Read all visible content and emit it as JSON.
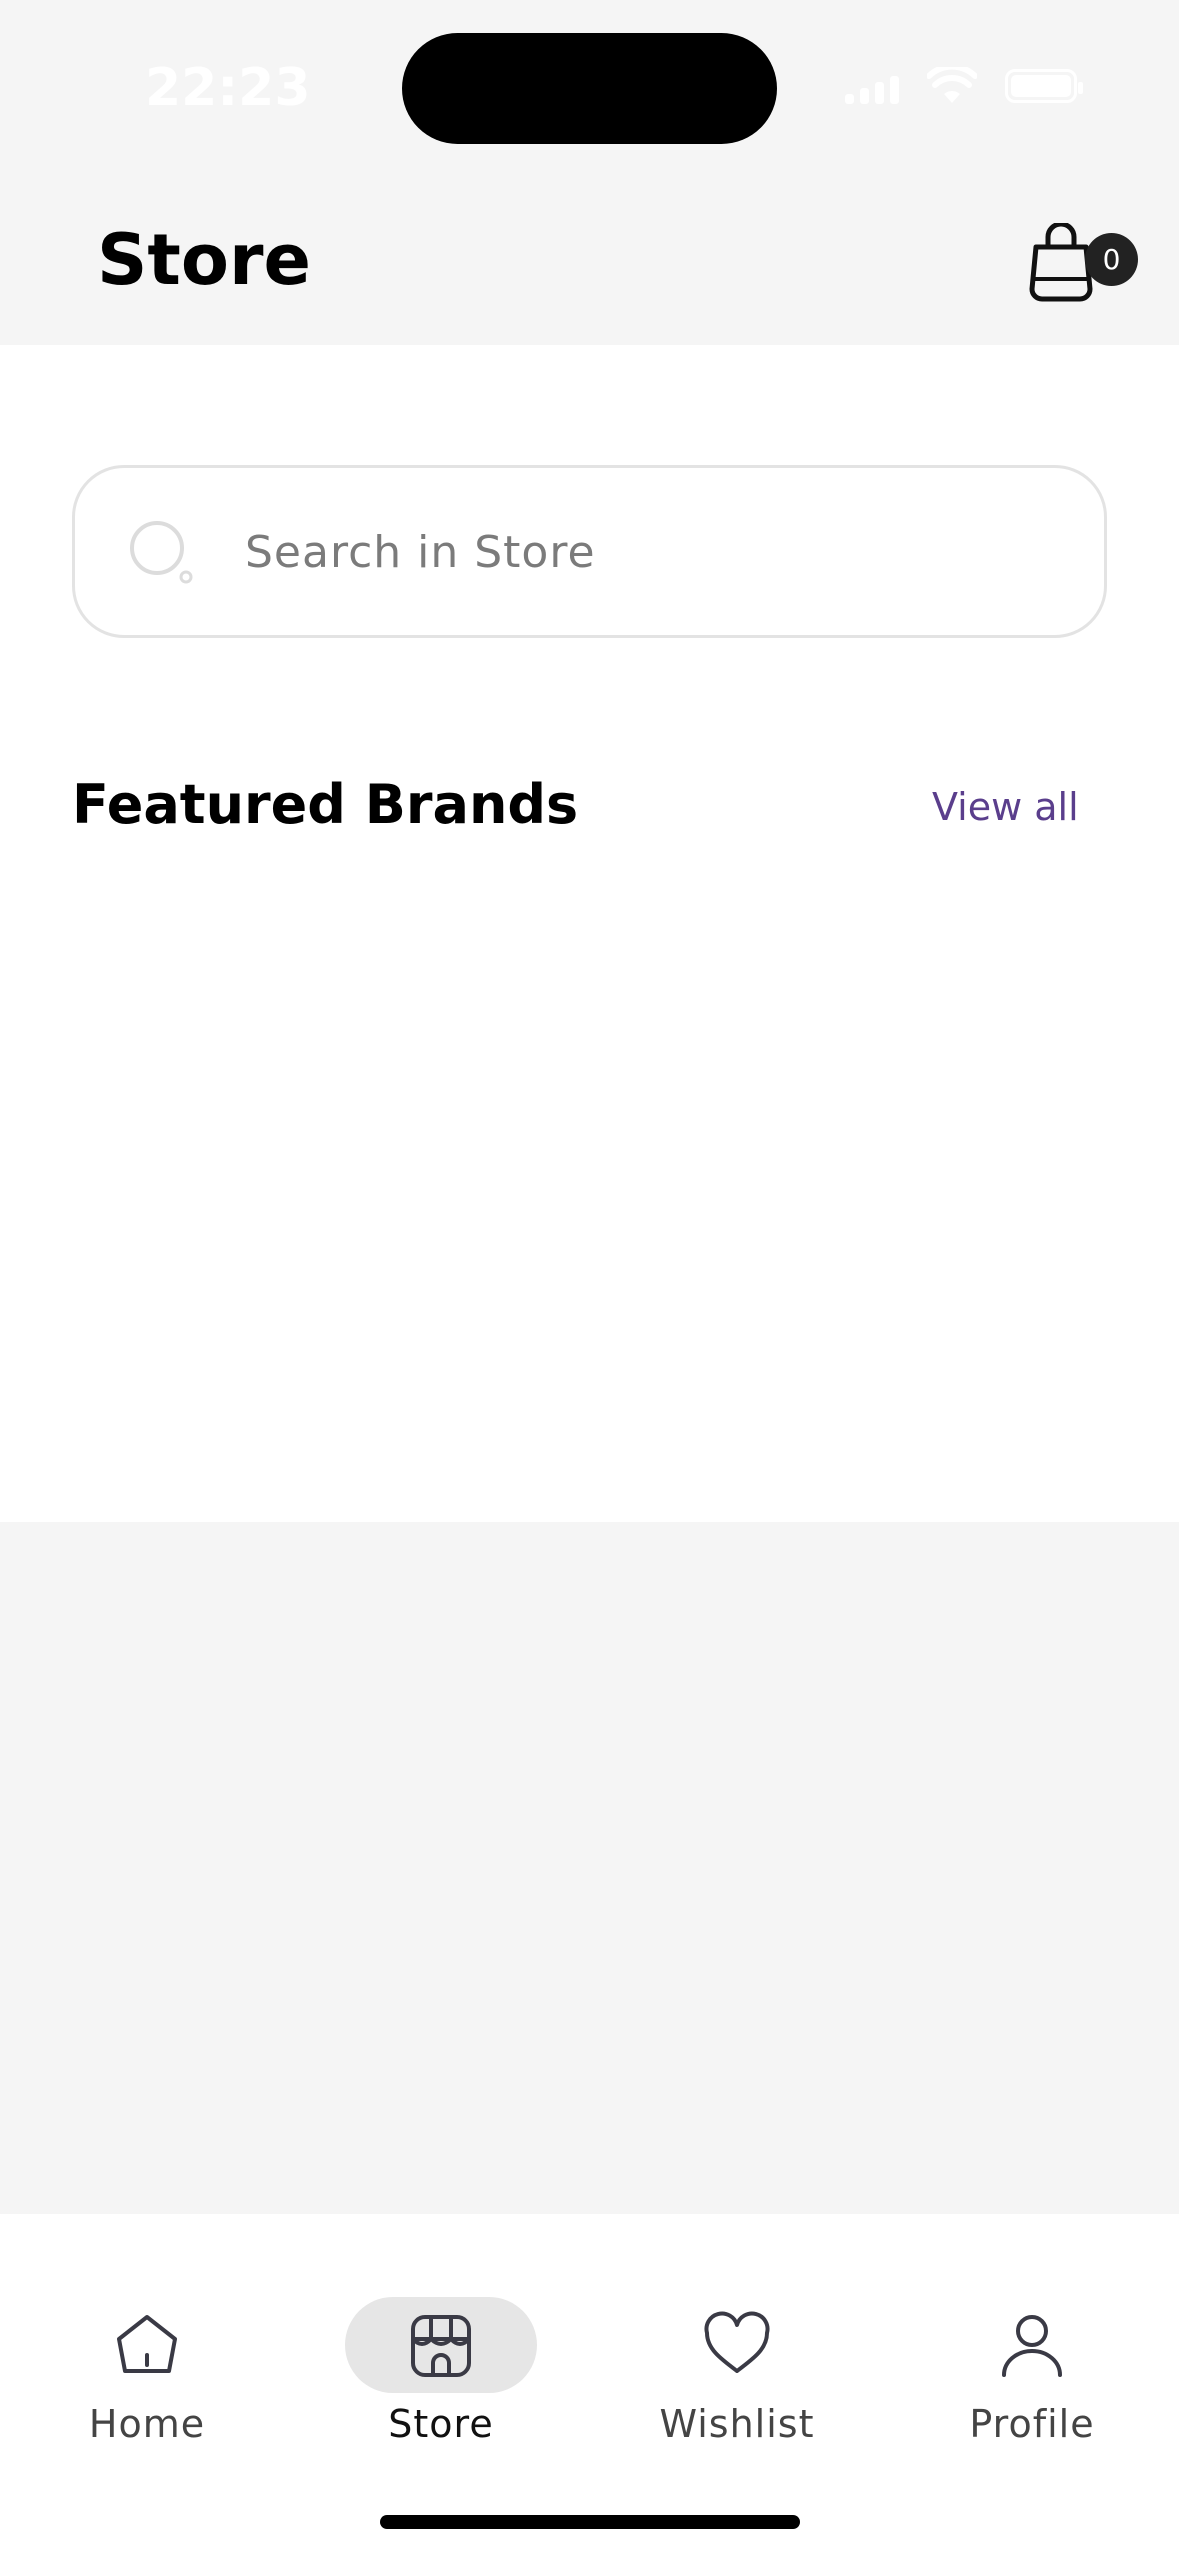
{
  "status_bar": {
    "time": "22:23"
  },
  "header": {
    "title": "Store",
    "cart_count": "0"
  },
  "search": {
    "placeholder": "Search in Store"
  },
  "featured": {
    "title": "Featured Brands",
    "view_all": "View all"
  },
  "nav": {
    "items": [
      {
        "label": "Home",
        "icon": "home-icon",
        "active": false
      },
      {
        "label": "Store",
        "icon": "store-icon",
        "active": true
      },
      {
        "label": "Wishlist",
        "icon": "heart-icon",
        "active": false
      },
      {
        "label": "Profile",
        "icon": "user-icon",
        "active": false
      }
    ]
  },
  "colors": {
    "accent": "#5a3e8c",
    "badge": "#222222",
    "background": "#f5f5f5"
  }
}
